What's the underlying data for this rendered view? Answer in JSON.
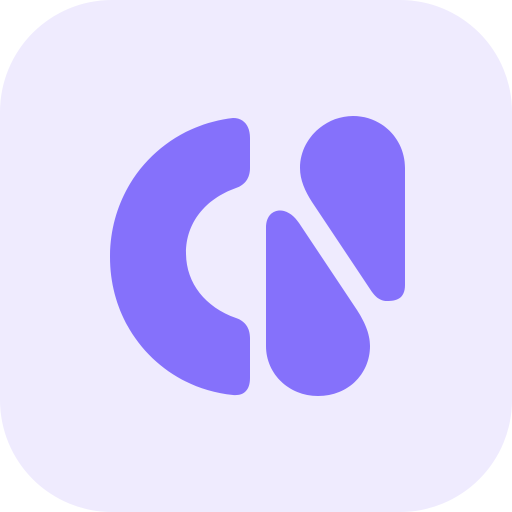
{
  "icon": {
    "name": "app-logo-icon",
    "colors": {
      "background": "#EFEBFE",
      "mark": "#8571FB"
    }
  }
}
